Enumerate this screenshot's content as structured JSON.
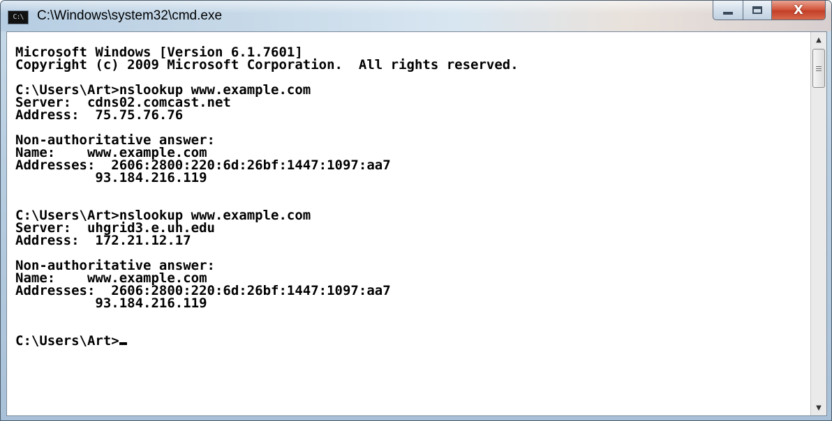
{
  "window": {
    "title": "C:\\Windows\\system32\\cmd.exe",
    "icon": "cmd-icon",
    "icon_text": "C:\\",
    "controls": {
      "minimize": "minimize-icon",
      "maximize": "maximize-icon",
      "close": "close-icon",
      "close_glyph": "X"
    }
  },
  "console": {
    "lines": [
      "Microsoft Windows [Version 6.1.7601]",
      "Copyright (c) 2009 Microsoft Corporation.  All rights reserved.",
      "",
      "C:\\Users\\Art>nslookup www.example.com",
      "Server:  cdns02.comcast.net",
      "Address:  75.75.76.76",
      "",
      "Non-authoritative answer:",
      "Name:    www.example.com",
      "Addresses:  2606:2800:220:6d:26bf:1447:1097:aa7",
      "          93.184.216.119",
      "",
      "",
      "C:\\Users\\Art>nslookup www.example.com",
      "Server:  uhgrid3.e.uh.edu",
      "Address:  172.21.12.17",
      "",
      "Non-authoritative answer:",
      "Name:    www.example.com",
      "Addresses:  2606:2800:220:6d:26bf:1447:1097:aa7",
      "          93.184.216.119",
      "",
      "",
      "C:\\Users\\Art>"
    ]
  },
  "scrollbar": {
    "up_icon": "scroll-up-arrow-icon",
    "down_icon": "scroll-down-arrow-icon",
    "up_glyph": "▲",
    "down_glyph": "▼",
    "position": 0
  },
  "colors": {
    "console_bg": "#ffffff",
    "console_text": "#000000",
    "close_button": "#c9452c"
  }
}
